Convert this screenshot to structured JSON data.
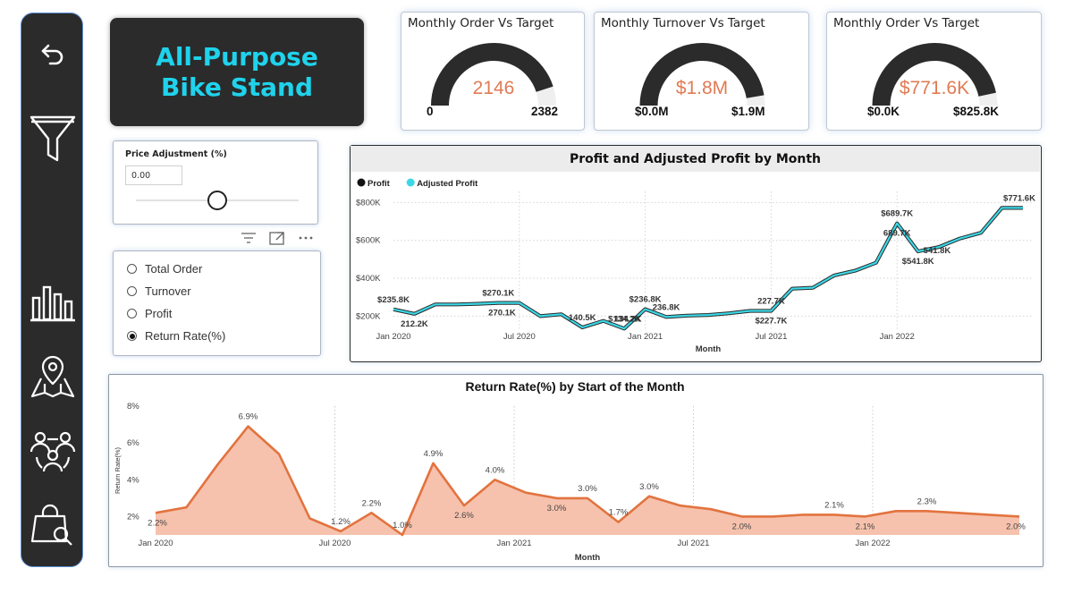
{
  "sidebar": {
    "items": [
      {
        "name": "back-icon"
      },
      {
        "name": "filter-icon"
      },
      {
        "name": "bar-chart-icon"
      },
      {
        "name": "map-pin-icon"
      },
      {
        "name": "customers-icon"
      },
      {
        "name": "product-search-icon"
      }
    ]
  },
  "title": "All-Purpose Bike Stand",
  "gauges": [
    {
      "title": "Monthly Order Vs Target",
      "value": "2146",
      "min": "0",
      "max": "2382",
      "fraction": 0.901
    },
    {
      "title": "Monthly Turnover Vs Target",
      "value": "$1.8M",
      "min": "$0.0M",
      "max": "$1.9M",
      "fraction": 0.947
    },
    {
      "title": "Monthly Order Vs Target",
      "value": "$771.6K",
      "min": "$0.0K",
      "max": "$825.8K",
      "fraction": 0.934
    }
  ],
  "gauge_colors": {
    "fill": "#2b2b2b",
    "track": "#efefef",
    "value": "#e07b54"
  },
  "slicer": {
    "label": "Price Adjustment (%)",
    "value": "0.00",
    "fraction": 0.5
  },
  "radio": {
    "options": [
      "Total Order",
      "Turnover",
      "Profit",
      "Return Rate(%)"
    ],
    "selected": "Return Rate(%)"
  },
  "chart_data": [
    {
      "type": "line",
      "title": "Profit and Adjusted Profit by Month",
      "xlabel": "Month",
      "ylabel": "",
      "legend": [
        "Profit",
        "Adjusted Profit"
      ],
      "legend_colors": [
        "#111111",
        "#3ad7e6"
      ],
      "legend_placement": "top-left",
      "x_ticks": [
        "Jan 2020",
        "Jul 2020",
        "Jan 2021",
        "Jul 2021",
        "Jan 2022"
      ],
      "y_ticks": [
        "$200K",
        "$400K",
        "$600K",
        "$800K"
      ],
      "ylim": [
        150,
        830
      ],
      "grid": true,
      "series": [
        {
          "name": "Profit",
          "color": "#2b2b2b",
          "values": [
            235.8,
            212.2,
            262,
            262,
            265,
            270.1,
            270.1,
            200,
            210,
            140.5,
            175,
            134.2,
            236.8,
            196,
            203,
            206,
            215,
            227.7,
            227.7,
            345,
            350,
            415,
            440,
            482,
            689.7,
            541.8,
            565,
            610,
            640,
            771.6,
            771.6
          ]
        },
        {
          "name": "Adjusted Profit",
          "color": "#3ad7e6",
          "values": [
            235.8,
            212.2,
            262,
            262,
            265,
            270.1,
            270.1,
            200,
            210,
            140.5,
            175,
            134.2,
            236.8,
            196,
            203,
            206,
            215,
            227.7,
            227.7,
            345,
            350,
            415,
            440,
            482,
            689.7,
            541.8,
            565,
            610,
            640,
            771.6,
            771.6
          ]
        }
      ],
      "labels": [
        {
          "i": 0,
          "text": "$235.8K",
          "pos": "above"
        },
        {
          "i": 1,
          "text": "212.2K",
          "pos": "below"
        },
        {
          "i": 5,
          "text": "$270.1K",
          "pos": "above"
        },
        {
          "i": 6,
          "text": "270.1K",
          "pos": "below-left"
        },
        {
          "i": 9,
          "text": "140.5K",
          "pos": "above"
        },
        {
          "i": 11,
          "text": "$134.2K",
          "pos": "above"
        },
        {
          "i": 12,
          "text": "134.2K",
          "pos": "below-left"
        },
        {
          "i": 12,
          "text": "$236.8K",
          "pos": "above"
        },
        {
          "i": 13,
          "text": "236.8K",
          "pos": "above"
        },
        {
          "i": 18,
          "text": "227.7K",
          "pos": "above"
        },
        {
          "i": 18,
          "text": "$227.7K",
          "pos": "below"
        },
        {
          "i": 24,
          "text": "$689.7K",
          "pos": "above"
        },
        {
          "i": 24,
          "text": "689.7K",
          "pos": "below"
        },
        {
          "i": 25,
          "text": "541.8K",
          "pos": "above-right"
        },
        {
          "i": 25,
          "text": "$541.8K",
          "pos": "below"
        },
        {
          "i": 30,
          "text": "$771.6K",
          "pos": "above"
        }
      ]
    },
    {
      "type": "area",
      "title": "Return Rate(%) by Start of the Month",
      "xlabel": "Month",
      "ylabel": "Return Rate(%)",
      "x_ticks": [
        "Jan 2020",
        "Jul 2020",
        "Jan 2021",
        "Jul 2021",
        "Jan 2022"
      ],
      "y_ticks": [
        "2%",
        "4%",
        "6%",
        "8%"
      ],
      "ylim": [
        1,
        8
      ],
      "grid": true,
      "line_color": "#e2733f",
      "fill_color": "#f6c2ad",
      "values": [
        2.2,
        2.5,
        4.8,
        6.9,
        5.4,
        1.9,
        1.2,
        2.2,
        1.0,
        4.9,
        2.6,
        4.0,
        3.3,
        3.0,
        3.0,
        1.7,
        3.1,
        2.6,
        2.4,
        2.0,
        2.0,
        2.1,
        2.1,
        2.0,
        2.3,
        2.3,
        2.2,
        2.1,
        2.0
      ],
      "labels": [
        {
          "i": 0,
          "text": "2.2%",
          "pos": "below"
        },
        {
          "i": 3,
          "text": "6.9%",
          "pos": "above"
        },
        {
          "i": 6,
          "text": "1.2%",
          "pos": "above"
        },
        {
          "i": 7,
          "text": "2.2%",
          "pos": "above"
        },
        {
          "i": 8,
          "text": "1.0%",
          "pos": "above"
        },
        {
          "i": 9,
          "text": "4.9%",
          "pos": "above"
        },
        {
          "i": 10,
          "text": "2.6%",
          "pos": "below"
        },
        {
          "i": 11,
          "text": "4.0%",
          "pos": "above"
        },
        {
          "i": 13,
          "text": "3.0%",
          "pos": "below"
        },
        {
          "i": 14,
          "text": "3.0%",
          "pos": "above"
        },
        {
          "i": 15,
          "text": "1.7%",
          "pos": "above"
        },
        {
          "i": 16,
          "text": "3.0%",
          "pos": "above"
        },
        {
          "i": 19,
          "text": "2.0%",
          "pos": "below"
        },
        {
          "i": 22,
          "text": "2.1%",
          "pos": "above"
        },
        {
          "i": 23,
          "text": "2.1%",
          "pos": "below"
        },
        {
          "i": 25,
          "text": "2.3%",
          "pos": "above"
        },
        {
          "i": 28,
          "text": "2.0%",
          "pos": "below"
        }
      ]
    }
  ]
}
